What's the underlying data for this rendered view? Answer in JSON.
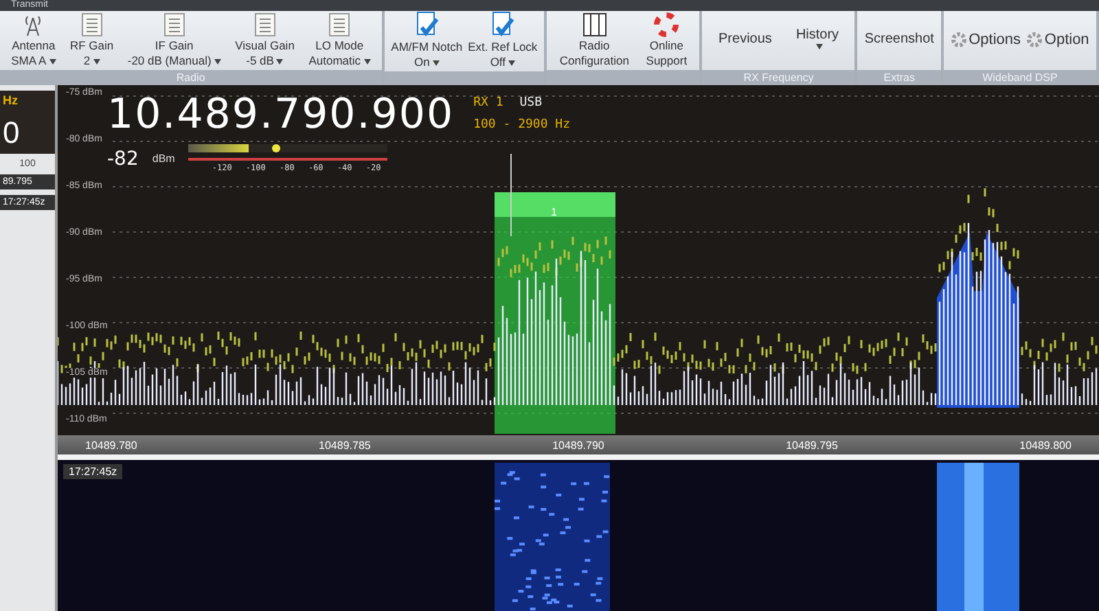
{
  "top_tab": "Transmit",
  "ribbon": {
    "groups": [
      {
        "label": "Radio",
        "items": [
          {
            "kind": "antenna",
            "title": "Antenna",
            "value": "SMA A"
          },
          {
            "kind": "list",
            "title": "RF Gain",
            "value": "2"
          },
          {
            "kind": "list",
            "title": "IF Gain",
            "value": "-20 dB (Manual)"
          },
          {
            "kind": "list",
            "title": "Visual Gain",
            "value": "-5 dB"
          },
          {
            "kind": "list",
            "title": "LO Mode",
            "value": "Automatic"
          }
        ]
      },
      {
        "items": [
          {
            "kind": "check",
            "title": "AM/FM Notch",
            "value": "On"
          },
          {
            "kind": "check",
            "title": "Ext. Ref Lock",
            "value": "Off"
          }
        ]
      },
      {
        "items": [
          {
            "kind": "config",
            "title": "Radio",
            "value": "Configuration"
          },
          {
            "kind": "support",
            "title": "Online",
            "value": "Support"
          }
        ]
      },
      {
        "label": "RX Frequency",
        "items": [
          {
            "kind": "plain",
            "title": "Previous"
          },
          {
            "kind": "menu",
            "title": "History"
          }
        ]
      },
      {
        "label": "Extras",
        "items": [
          {
            "kind": "plain",
            "title": "Screenshot"
          }
        ]
      },
      {
        "label": "Wideband DSP",
        "items": [
          {
            "kind": "gear",
            "title": "Options"
          },
          {
            "kind": "gear",
            "title": "Option"
          }
        ]
      }
    ]
  },
  "side_panel": {
    "unit": "Hz",
    "value": "0",
    "number": "100",
    "frequency": "89.795",
    "time": "17:27:45z"
  },
  "readout": {
    "frequency": "10.489.790.900",
    "receiver": "RX 1",
    "mode": "USB",
    "bandwidth": "100 - 2900 Hz",
    "signal": "-82",
    "signal_unit": "dBm",
    "meter": {
      "level": 0.3,
      "scale": [
        "-120",
        "-100",
        "-80",
        "-60",
        "-40",
        "-20"
      ]
    }
  },
  "spectrum": {
    "y_labels": [
      "-75 dBm",
      "-80 dBm",
      "-85 dBm",
      "-90 dBm",
      "-95 dBm",
      "-100 dBm",
      "-105 dBm",
      "-110 dBm"
    ],
    "filter_label": "1",
    "freq_labels": [
      "10489.780",
      "10489.785",
      "10489.790",
      "10489.795",
      "10489.800"
    ]
  },
  "waterfall": {
    "time": "17:27:45z"
  }
}
